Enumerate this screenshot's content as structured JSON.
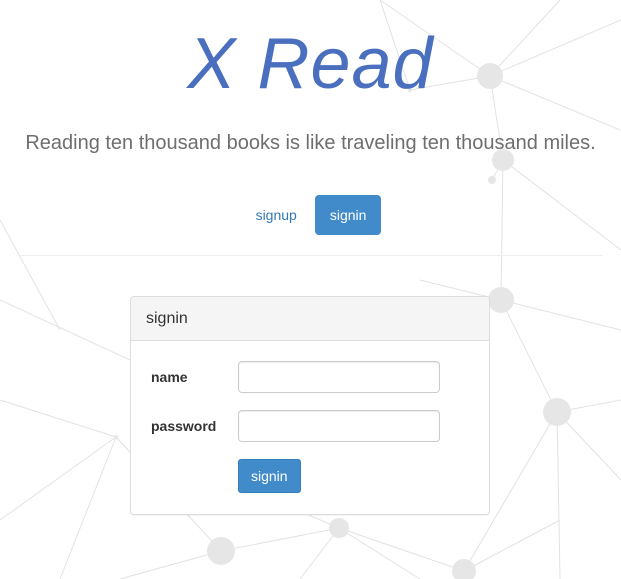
{
  "header": {
    "title": "X Read",
    "tagline": "Reading ten thousand books is like traveling ten thousand miles."
  },
  "nav": {
    "signup_label": "signup",
    "signin_label": "signin",
    "active": "signin"
  },
  "panel": {
    "heading": "signin",
    "fields": {
      "name_label": "name",
      "name_value": "",
      "password_label": "password",
      "password_value": ""
    },
    "submit_label": "signin"
  },
  "colors": {
    "title": "#4a6fbe",
    "primary": "#428bca",
    "link": "#337ab7",
    "panel_heading_bg": "#f5f5f5"
  },
  "background": {
    "type": "network-particle-decoration"
  }
}
